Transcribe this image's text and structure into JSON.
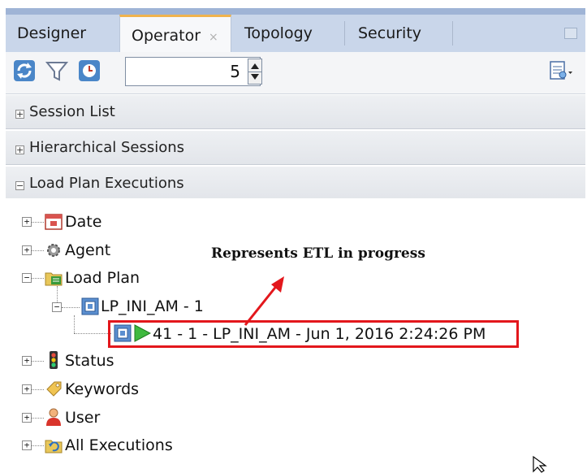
{
  "tabs": [
    {
      "label": "Designer",
      "active": false
    },
    {
      "label": "Operator",
      "active": true,
      "close": "×"
    },
    {
      "label": "Topology",
      "active": false
    },
    {
      "label": "Security",
      "active": false
    }
  ],
  "toolbar": {
    "icons": [
      "refresh-icon",
      "filter-icon",
      "auto-refresh-icon"
    ],
    "count_value": "5",
    "right_icon": "report-menu-icon"
  },
  "sections": [
    {
      "label": "Session List",
      "state": "+"
    },
    {
      "label": "Hierarchical Sessions",
      "state": "+"
    },
    {
      "label": "Load Plan Executions",
      "state": "−"
    }
  ],
  "tree": {
    "date": "Date",
    "agent": "Agent",
    "load_plan": "Load Plan",
    "lp_instance": "LP_INI_AM - 1",
    "execution": "41 - 1 - LP_INI_AM - Jun 1, 2016 2:24:26 PM",
    "status": "Status",
    "keywords": "Keywords",
    "user": "User",
    "all_executions": "All Executions"
  },
  "annotation": "Represents ETL in progress",
  "colors": {
    "highlight": "#e3171c",
    "tab_accent": "#f0b34d",
    "tabbar": "#c9d6ea"
  }
}
